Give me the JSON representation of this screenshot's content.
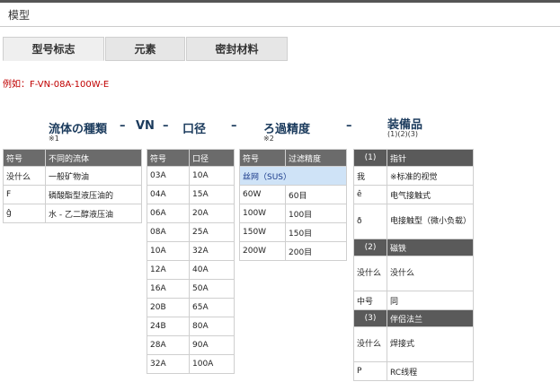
{
  "section_title": "模型",
  "tabs": [
    "型号标志",
    "元素",
    "密封材料"
  ],
  "example": "例如：F-VN-08A-100W-E",
  "headers": {
    "fluid_type": "流体の種類",
    "fluid_note": "※1",
    "vn": "VN",
    "port": "口径",
    "filtration": "ろ過精度",
    "filtration_note": "※2",
    "equipment": "装備品",
    "equipment_note": "(1)(2)(3)",
    "dash": "–"
  },
  "fluid_table": {
    "cols": [
      "符号",
      "不同的流体"
    ],
    "rows": [
      [
        "没什么",
        "一般矿物油"
      ],
      [
        "F",
        "磷酸酯型液压油的"
      ],
      [
        "ĝ",
        "水 - 乙二醇液压油"
      ]
    ]
  },
  "port_table": {
    "cols": [
      "符号",
      "口径"
    ],
    "rows": [
      [
        "03A",
        "10A"
      ],
      [
        "04A",
        "15A"
      ],
      [
        "06A",
        "20A"
      ],
      [
        "08A",
        "25A"
      ],
      [
        "10A",
        "32A"
      ],
      [
        "12A",
        "40A"
      ],
      [
        "16A",
        "50A"
      ],
      [
        "20B",
        "65A"
      ],
      [
        "24B",
        "80A"
      ],
      [
        "28A",
        "90A"
      ],
      [
        "32A",
        "100A"
      ]
    ]
  },
  "filter_table": {
    "cols": [
      "符号",
      "过滤精度"
    ],
    "subheader": "丝网（SUS）",
    "rows": [
      [
        "60W",
        "60目"
      ],
      [
        "100W",
        "100目"
      ],
      [
        "150W",
        "150目"
      ],
      [
        "200W",
        "200目"
      ]
    ]
  },
  "equip_table": {
    "groups": [
      {
        "num": "(1)",
        "name": "指针",
        "rows": [
          [
            "我",
            "※标准的视觉"
          ],
          [
            "ê",
            "电气接触式"
          ],
          [
            "ð",
            "电接触型（微小负载）"
          ]
        ]
      },
      {
        "num": "(2)",
        "name": "磁铁",
        "rows": [
          [
            "没什么",
            "没什么"
          ],
          [
            "中号",
            "同"
          ]
        ]
      },
      {
        "num": "(3)",
        "name": "伴侣法兰",
        "rows": [
          [
            "没什么",
            "焊接式"
          ],
          [
            "P",
            "RC线程"
          ]
        ]
      }
    ]
  }
}
